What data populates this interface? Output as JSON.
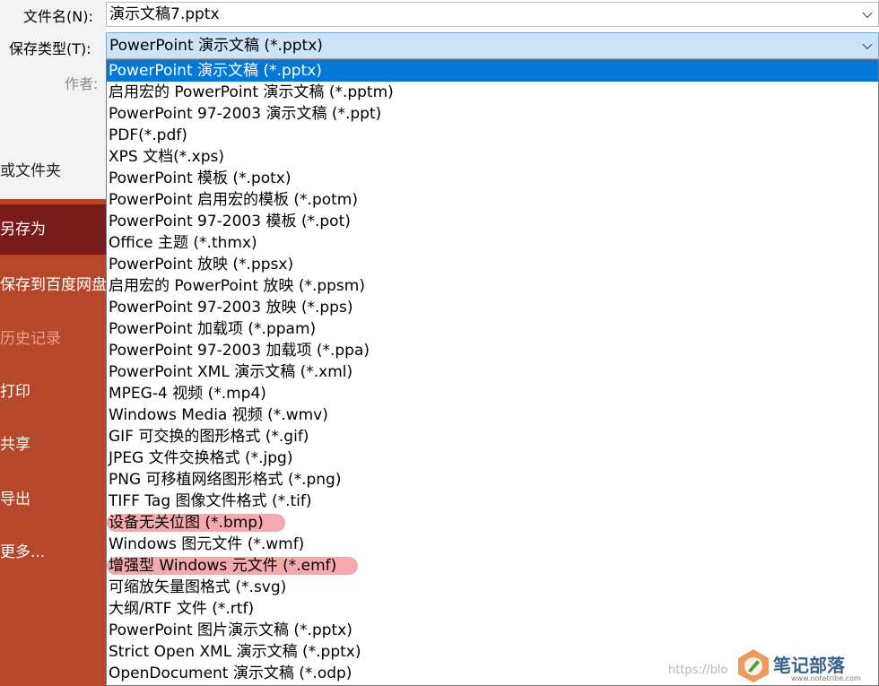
{
  "form": {
    "filename_label": "文件名(N):",
    "filename_value": "演示文稿7.pptx",
    "type_label": "保存类型(T):",
    "type_value": "PowerPoint 演示文稿 (*.pptx)",
    "author_label": "作者:"
  },
  "background": {
    "partial_label": "或文件夹"
  },
  "sidebar": {
    "items": [
      {
        "label": "另存为",
        "state": "active"
      },
      {
        "label": "保存到百度网盘",
        "state": "normal"
      },
      {
        "label": "历史记录",
        "state": "disabled"
      },
      {
        "label": "打印",
        "state": "normal"
      },
      {
        "label": "共享",
        "state": "normal"
      },
      {
        "label": "导出",
        "state": "normal"
      },
      {
        "label": "更多...",
        "state": "normal"
      }
    ]
  },
  "dropdown": {
    "options": [
      {
        "label": "PowerPoint 演示文稿 (*.pptx)",
        "selected": true
      },
      {
        "label": "启用宏的 PowerPoint 演示文稿 (*.pptm)"
      },
      {
        "label": "PowerPoint 97-2003 演示文稿 (*.ppt)"
      },
      {
        "label": "PDF(*.pdf)"
      },
      {
        "label": "XPS 文档(*.xps)"
      },
      {
        "label": "PowerPoint 模板 (*.potx)"
      },
      {
        "label": "PowerPoint 启用宏的模板 (*.potm)"
      },
      {
        "label": "PowerPoint 97-2003 模板 (*.pot)"
      },
      {
        "label": "Office 主题 (*.thmx)"
      },
      {
        "label": "PowerPoint 放映 (*.ppsx)"
      },
      {
        "label": "启用宏的 PowerPoint 放映 (*.ppsm)"
      },
      {
        "label": "PowerPoint 97-2003 放映 (*.pps)"
      },
      {
        "label": "PowerPoint 加载项 (*.ppam)"
      },
      {
        "label": "PowerPoint 97-2003 加载项 (*.ppa)"
      },
      {
        "label": "PowerPoint XML 演示文稿 (*.xml)"
      },
      {
        "label": "MPEG-4 视频 (*.mp4)"
      },
      {
        "label": "Windows Media 视频 (*.wmv)"
      },
      {
        "label": "GIF 可交换的图形格式 (*.gif)"
      },
      {
        "label": "JPEG 文件交换格式 (*.jpg)"
      },
      {
        "label": "PNG 可移植网络图形格式 (*.png)"
      },
      {
        "label": "TIFF Tag 图像文件格式 (*.tif)"
      },
      {
        "label": "设备无关位图 (*.bmp)",
        "highlighted": true
      },
      {
        "label": "Windows 图元文件 (*.wmf)"
      },
      {
        "label": "增强型 Windows 元文件 (*.emf)",
        "highlighted": true
      },
      {
        "label": "可缩放矢量图格式 (*.svg)"
      },
      {
        "label": "大纲/RTF 文件 (*.rtf)"
      },
      {
        "label": "PowerPoint 图片演示文稿 (*.pptx)"
      },
      {
        "label": "Strict Open XML 演示文稿 (*.pptx)"
      },
      {
        "label": "OpenDocument 演示文稿 (*.odp)"
      }
    ]
  },
  "watermark": {
    "url": "https://blo",
    "logo_text": "笔记部落",
    "logo_sub": "www.notetribe.com"
  },
  "colors": {
    "sidebar_bg": "#b7472a",
    "sidebar_active_bg": "#7a1b1b",
    "selection_blue": "#0078d7",
    "select_bg": "#cce4f7",
    "highlight_pink": "#ee6e78"
  }
}
